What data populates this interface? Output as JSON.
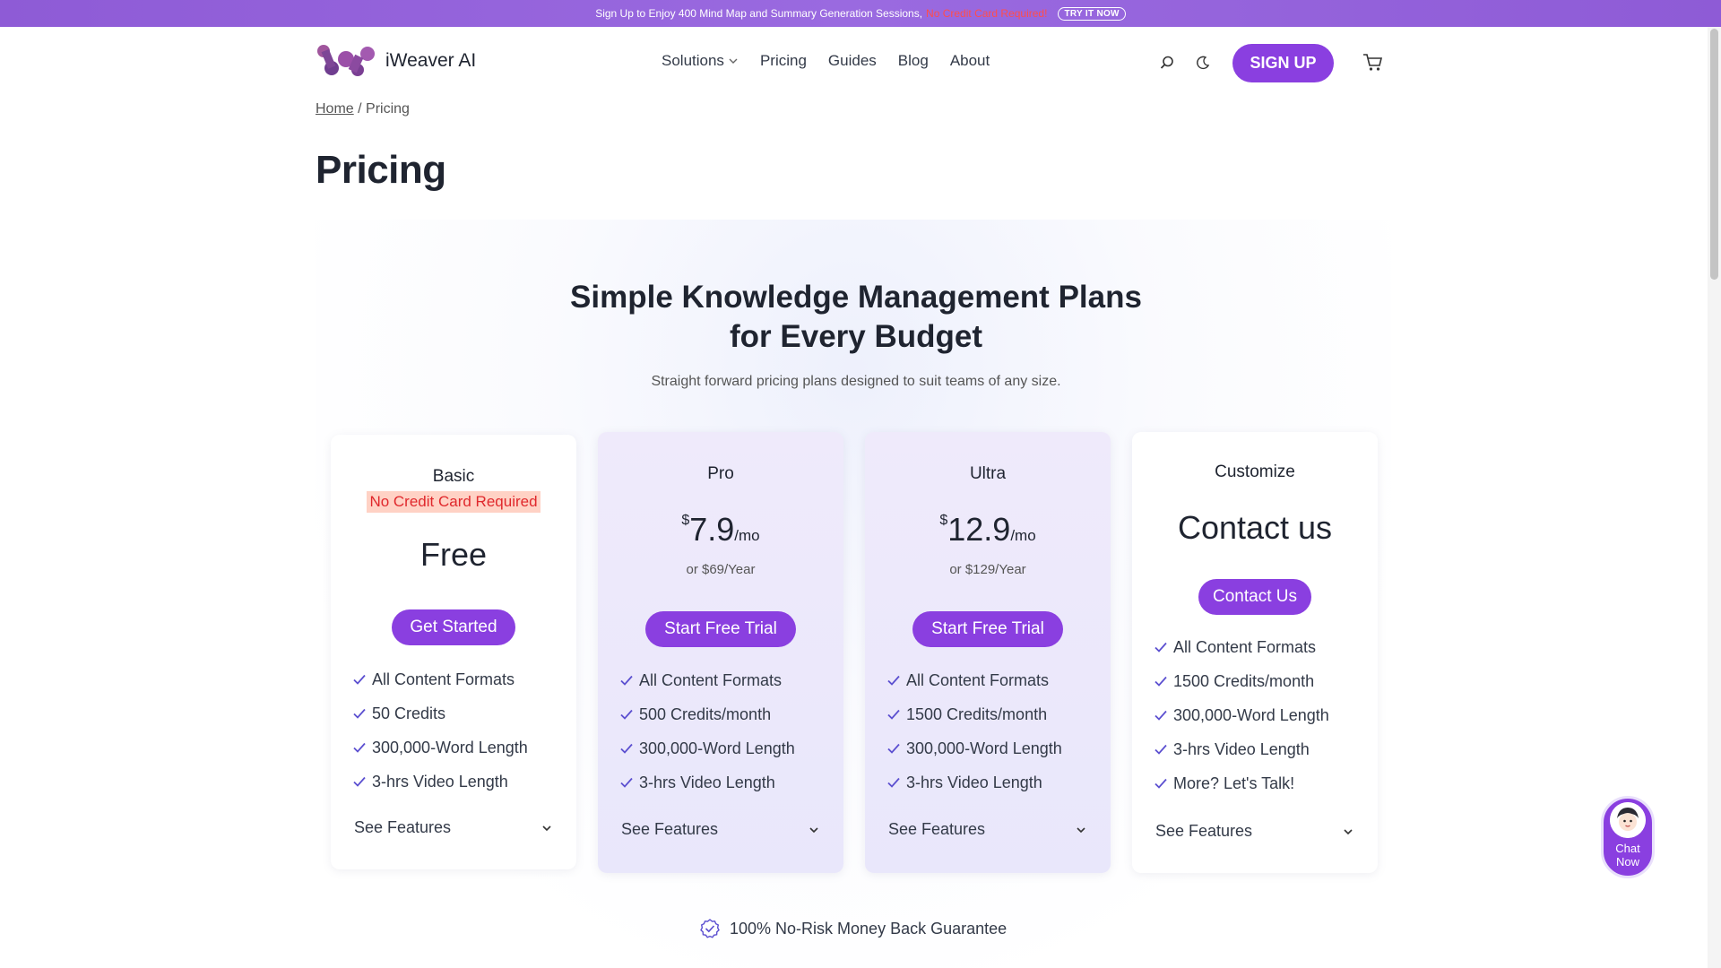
{
  "promo": {
    "text": "Sign Up to Enjoy 400 Mind Map and Summary Generation Sessions,",
    "highlight": "No Credit Card Required!",
    "cta": "TRY IT NOW"
  },
  "header": {
    "logo_text": "iWeaver AI",
    "nav": [
      "Solutions",
      "Pricing",
      "Guides",
      "Blog",
      "About"
    ],
    "signup_label": "SIGN UP"
  },
  "breadcrumb": {
    "home": "Home",
    "separator": "/",
    "current": "Pricing"
  },
  "page_title": "Pricing",
  "hero": {
    "title_line1": "Simple Knowledge Management Plans",
    "title_line2": "for Every Budget",
    "subtitle": "Straight forward pricing plans designed to suit teams of any size."
  },
  "plans": [
    {
      "name": "Basic",
      "badge": "No Credit Card Required",
      "price": "Free",
      "button": "Get Started",
      "features": [
        "All Content Formats",
        "50 Credits",
        "300,000-Word Length",
        "3-hrs Video Length"
      ],
      "see_features": "See Features"
    },
    {
      "name": "Pro",
      "currency": "$",
      "price": "7.9",
      "period": "/mo",
      "yearly": "or $69/Year",
      "button": "Start Free Trial",
      "features": [
        "All Content Formats",
        "500 Credits/month",
        "300,000-Word Length",
        "3-hrs Video Length"
      ],
      "see_features": "See Features"
    },
    {
      "name": "Ultra",
      "currency": "$",
      "price": "12.9",
      "period": "/mo",
      "yearly": "or $129/Year",
      "button": "Start Free Trial",
      "features": [
        "All Content Formats",
        "1500 Credits/month",
        "300,000-Word Length",
        "3-hrs Video Length"
      ],
      "see_features": "See Features"
    },
    {
      "name": "Customize",
      "price": "Contact us",
      "button": "Contact Us",
      "features": [
        "All Content Formats",
        "1500 Credits/month",
        "300,000-Word Length",
        "3-hrs Video Length",
        "More? Let's Talk!"
      ],
      "see_features": "See Features"
    }
  ],
  "guarantee": "100% No-Risk Money Back Guarantee",
  "chat": {
    "line1": "Chat",
    "line2": "Now"
  },
  "colors": {
    "accent": "#8a3fe0",
    "banner": "#9a6ae0",
    "badge_bg": "#ffd2c5",
    "badge_text": "#e0282c"
  }
}
